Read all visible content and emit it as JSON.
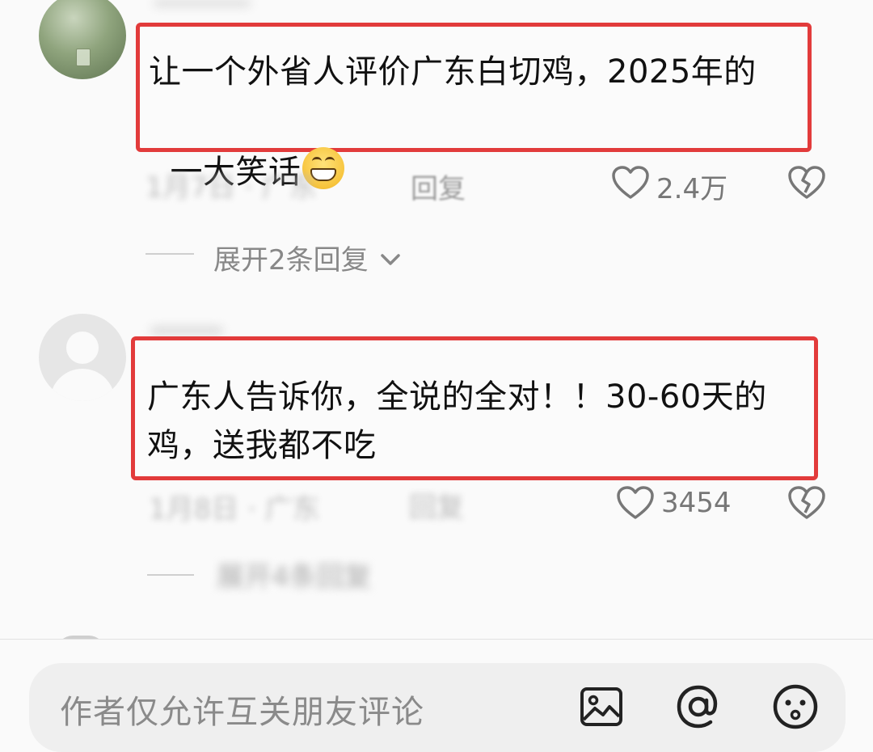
{
  "comments": [
    {
      "text_line1": "让一个外省人评价广东白切鸡，2025年的",
      "text_line2": "一大笑话",
      "emoji": "grinning-face",
      "reply_label": "回复",
      "like_count": "2.4万",
      "expand_label": "展开2条回复"
    },
    {
      "text_line1": "广东人告诉你，全说的全对！！30-60天的",
      "text_line2": "鸡，送我都不吃",
      "reply_label": "回复",
      "like_count": "3454",
      "expand_label": "展开4条回复"
    }
  ],
  "input": {
    "placeholder": "作者仅允许互关朋友评论"
  },
  "icons": [
    "heart-icon",
    "dislike-broken-heart-icon",
    "chevron-down-icon",
    "image-icon",
    "at-icon",
    "emoji-icon"
  ],
  "colors": {
    "highlight_border": "#e23b3b",
    "muted_text": "#888888"
  }
}
